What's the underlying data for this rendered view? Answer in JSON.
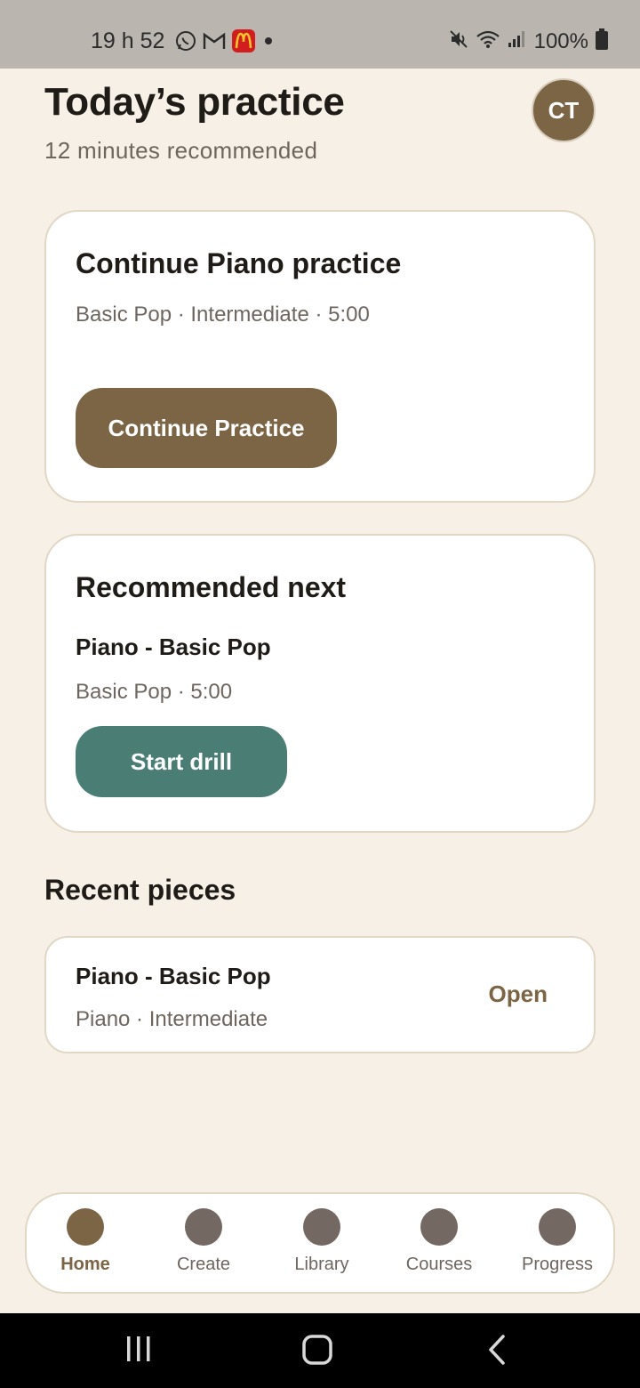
{
  "status_bar": {
    "time": "19 h 52",
    "battery_text": "100%",
    "icons_left": [
      "whatsapp-icon",
      "gmail-icon",
      "mcdonalds-icon",
      "dot-icon"
    ],
    "icons_right": [
      "mute-icon",
      "wifi-icon",
      "signal-icon",
      "battery-icon"
    ]
  },
  "header": {
    "title": "Today’s practice",
    "subtitle": "12 minutes recommended",
    "avatar_initials": "CT"
  },
  "continue_card": {
    "title": "Continue Piano practice",
    "meta": "Basic Pop · Intermediate · 5:00",
    "button_label": "Continue Practice"
  },
  "recommended_card": {
    "title": "Recommended next",
    "piece_title": "Piano - Basic Pop",
    "meta": "Basic Pop · 5:00",
    "button_label": "Start drill"
  },
  "recent": {
    "section_title": "Recent pieces",
    "items": [
      {
        "title": "Piano - Basic Pop",
        "meta": "Piano · Intermediate",
        "action_label": "Open"
      }
    ]
  },
  "bottom_nav": {
    "items": [
      {
        "label": "Home",
        "active": true
      },
      {
        "label": "Create",
        "active": false
      },
      {
        "label": "Library",
        "active": false
      },
      {
        "label": "Courses",
        "active": false
      },
      {
        "label": "Progress",
        "active": false
      }
    ]
  },
  "colors": {
    "background": "#f6f0e6",
    "accent_brown": "#7b6545",
    "accent_teal": "#4a7d74",
    "card_border": "#e2d6c4",
    "muted_text": "#6e665e"
  }
}
